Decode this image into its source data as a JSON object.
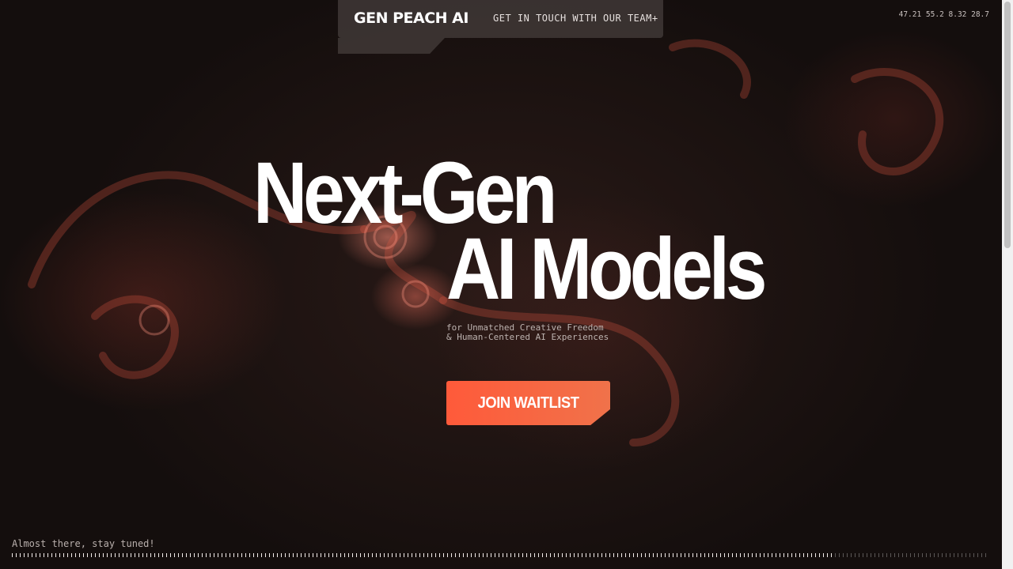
{
  "nav": {
    "logo": "GEN PEACH AI",
    "contact_link": "GET IN TOUCH WITH OUR TEAM+"
  },
  "coords_readout": "47.21 55.2 8.32 28.7",
  "hero": {
    "headline_line1": "Next-Gen",
    "headline_line2": "AI Models",
    "subtitle_line1": "for Unmatched Creative Freedom",
    "subtitle_line2": "& Human-Centered AI Experiences"
  },
  "cta": {
    "join_label": "JOIN WAITLIST"
  },
  "footer": {
    "status_text": "Almost there, stay tuned!",
    "progress": 0.84
  },
  "colors": {
    "background": "#1a1210",
    "accent": "#ff5a3a",
    "accent_end": "#f0724a"
  }
}
